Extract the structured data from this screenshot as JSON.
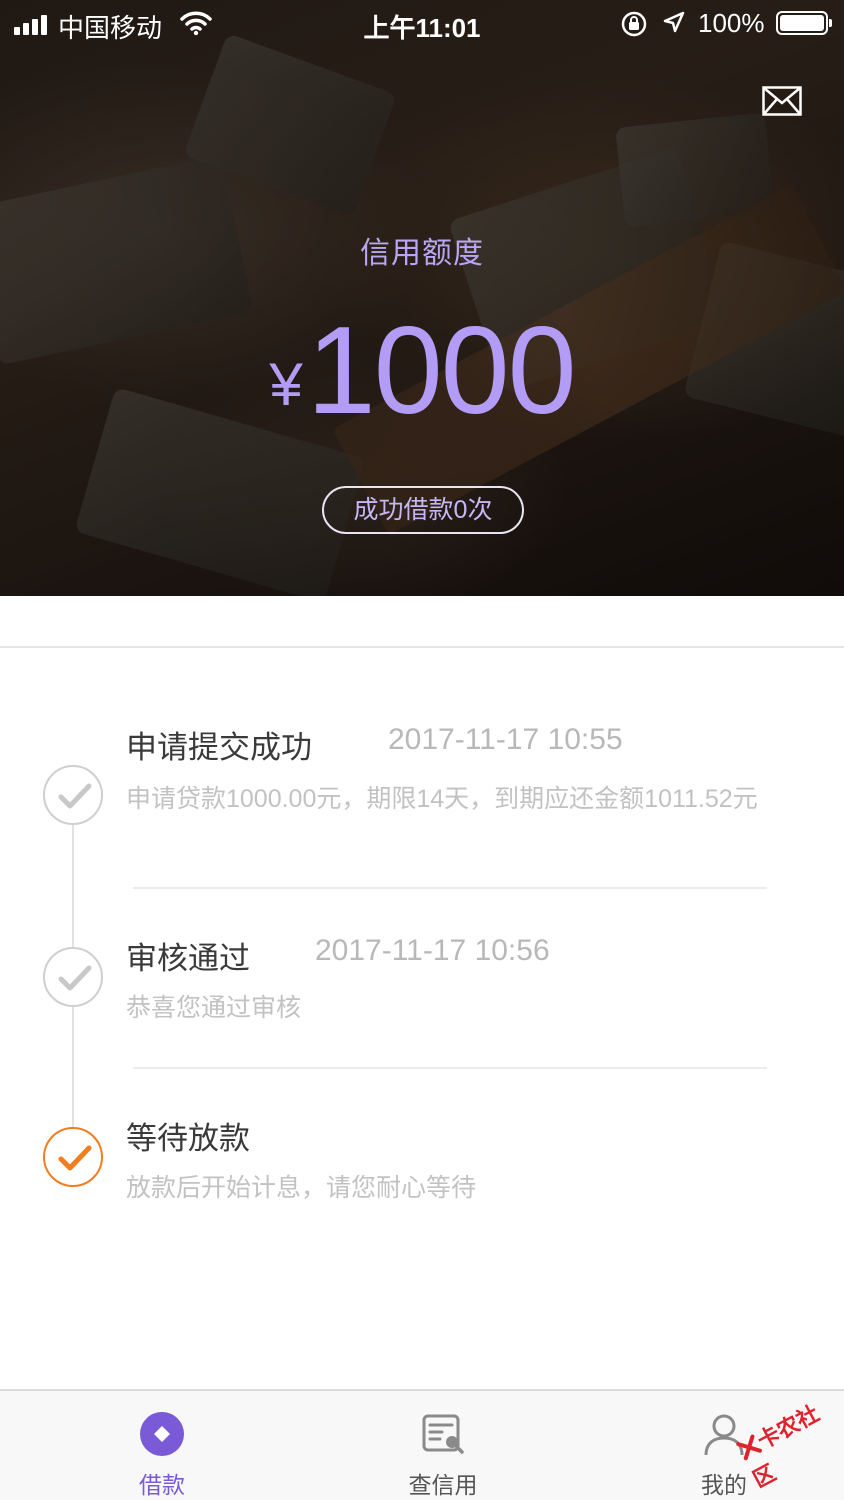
{
  "status_bar": {
    "carrier": "中国移动",
    "time": "上午11:01",
    "battery": "100%"
  },
  "header": {
    "credit_label": "信用额度",
    "currency": "¥",
    "amount": "1000",
    "loan_count": "成功借款0次",
    "accent_color": "#b39cf5"
  },
  "timeline": [
    {
      "title": "申请提交成功",
      "time": "2017-11-17 10:55",
      "desc": "申请贷款1000.00元，期限14天，到期应还金额1011.52元",
      "status": "done"
    },
    {
      "title": "审核通过",
      "time": "2017-11-17 10:56",
      "desc": "恭喜您通过审核",
      "status": "done"
    },
    {
      "title": "等待放款",
      "time": "",
      "desc": "放款后开始计息，请您耐心等待",
      "status": "current",
      "color": "#f07d1e"
    }
  ],
  "tabbar": {
    "items": [
      {
        "label": "借款",
        "icon": "diamond-icon",
        "active": true
      },
      {
        "label": "查信用",
        "icon": "credit-check-icon",
        "active": false
      },
      {
        "label": "我的",
        "icon": "user-icon",
        "active": false
      }
    ],
    "active_color": "#7a5ad6"
  },
  "watermark": "卡农社区"
}
